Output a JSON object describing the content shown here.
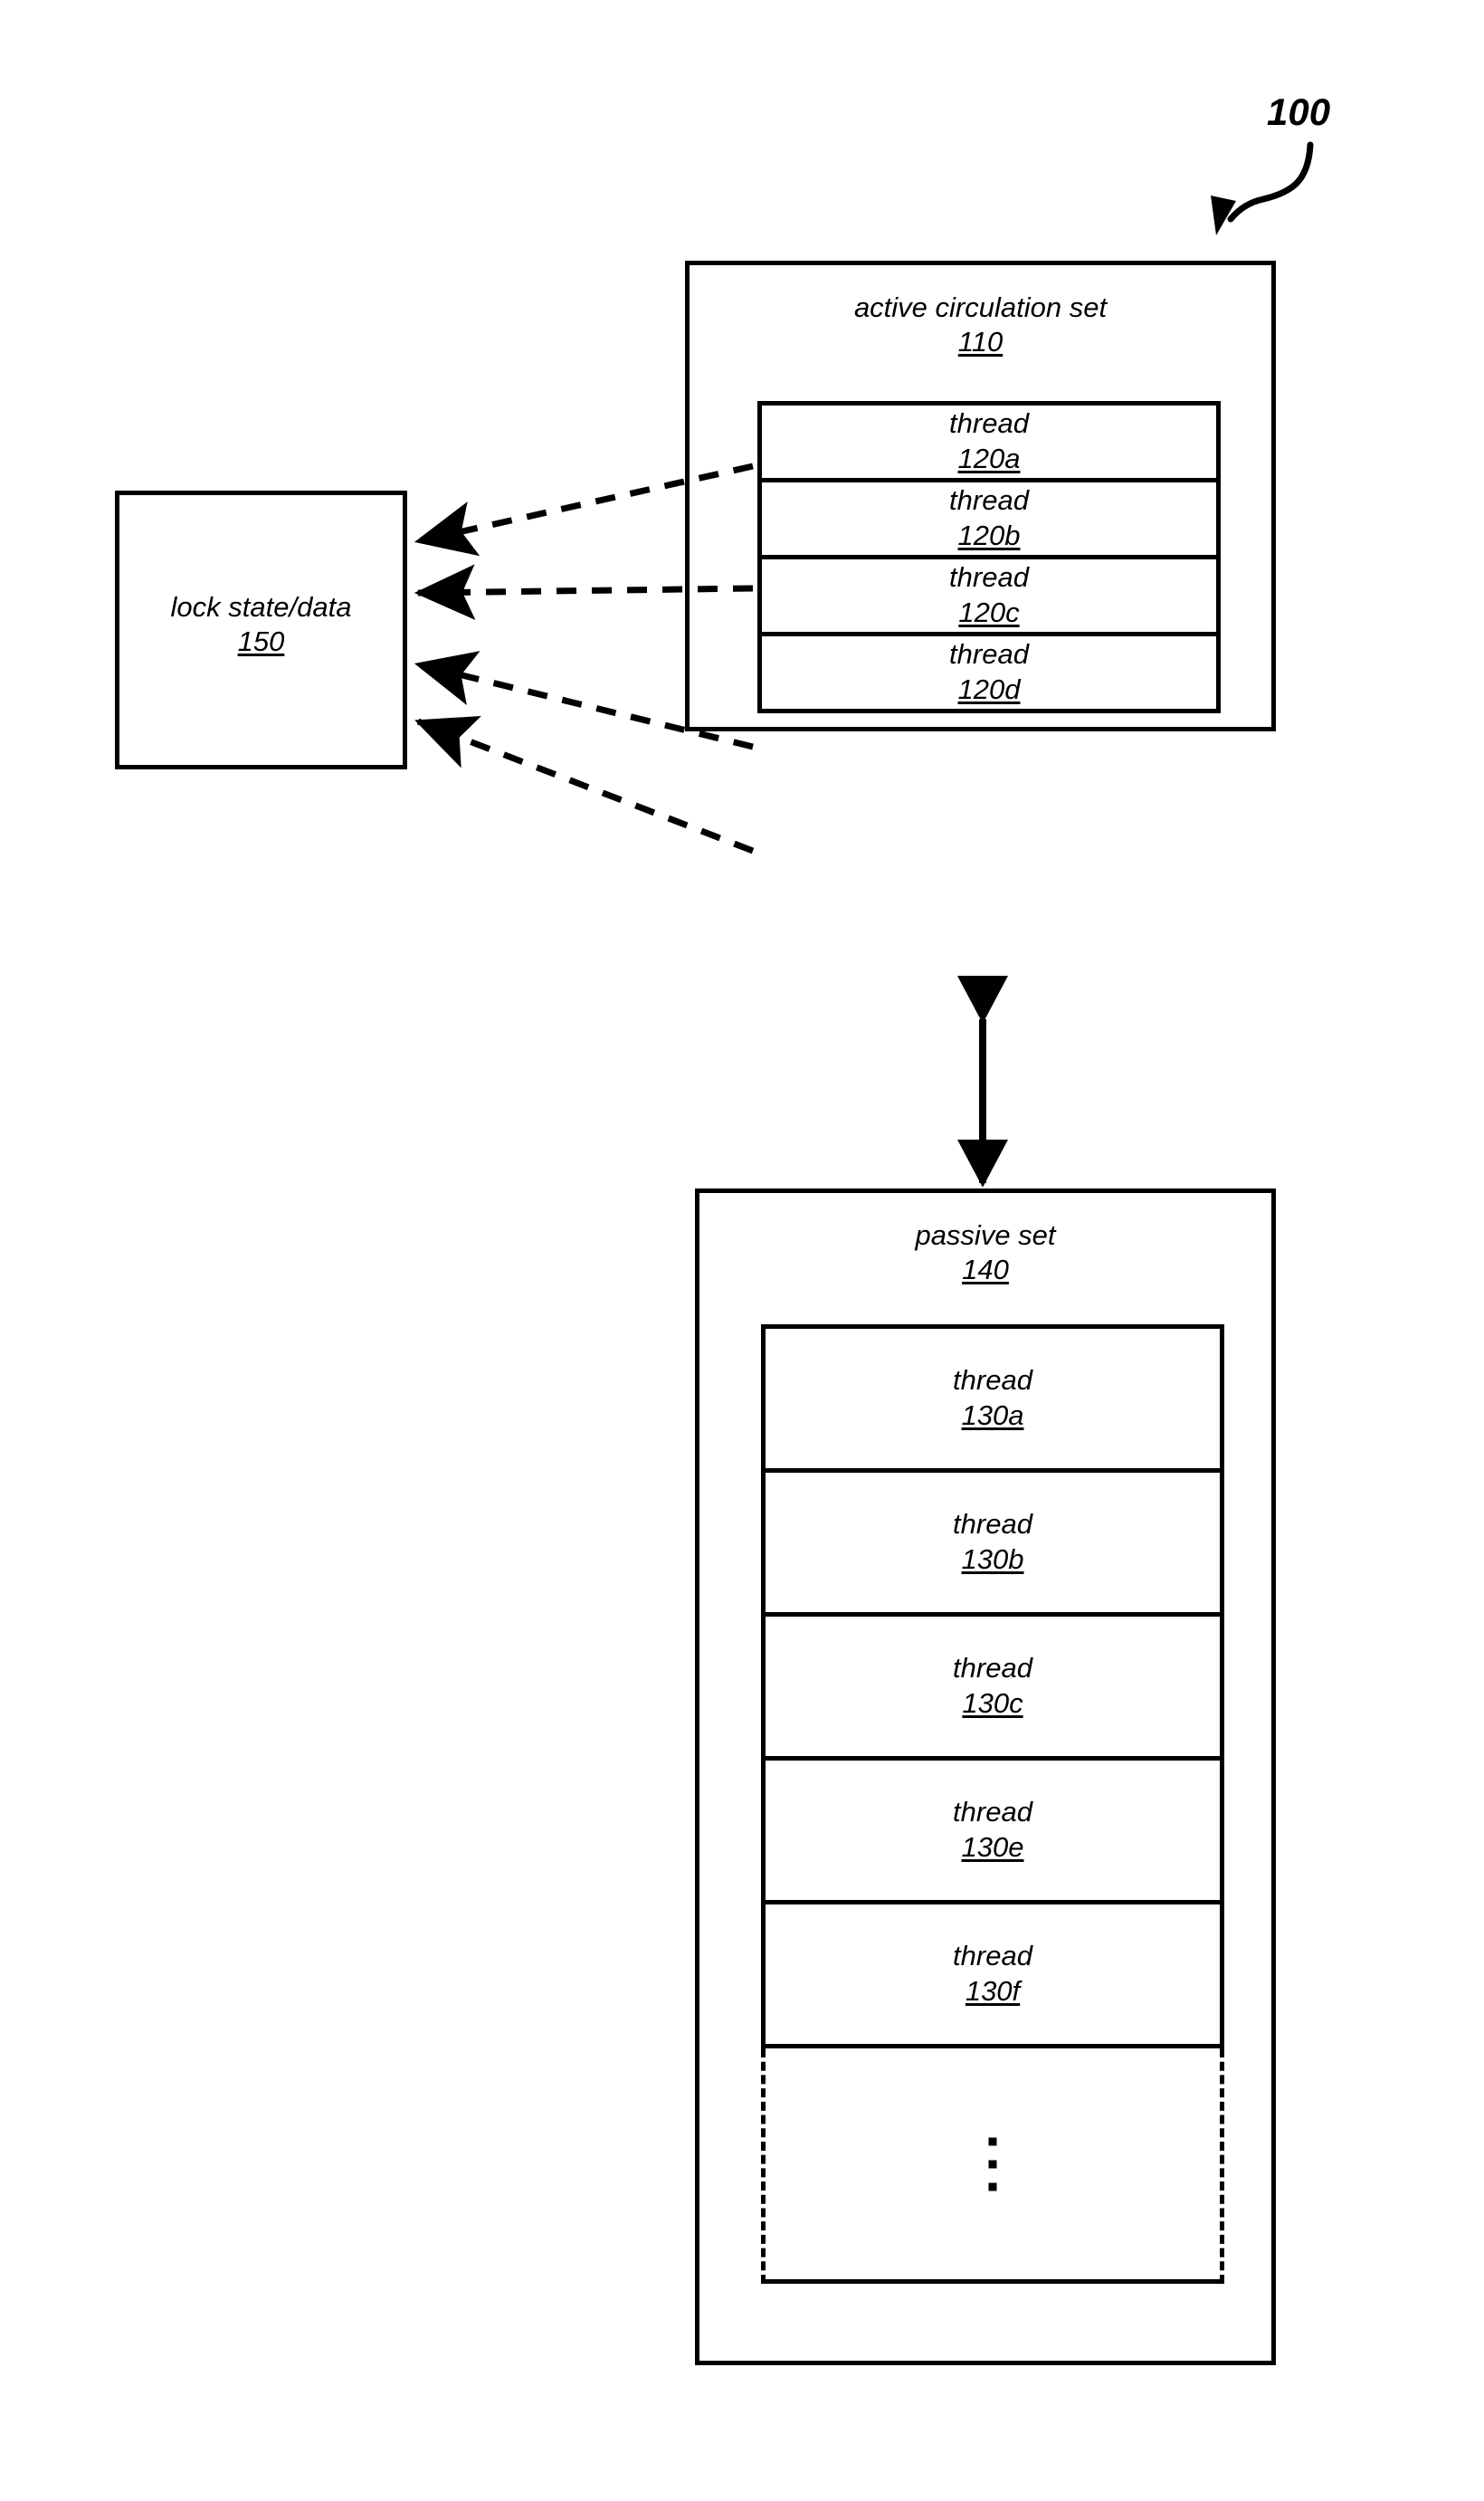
{
  "figure": {
    "number": "100",
    "number_icon": "curved-arrow-icon"
  },
  "lock": {
    "title": "lock state/data",
    "ref": "150"
  },
  "active_set": {
    "title": "active circulation set",
    "ref": "110",
    "threads": [
      {
        "title": "thread",
        "ref": "120a"
      },
      {
        "title": "thread",
        "ref": "120b"
      },
      {
        "title": "thread",
        "ref": "120c"
      },
      {
        "title": "thread",
        "ref": "120d"
      }
    ]
  },
  "passive_set": {
    "title": "passive set",
    "ref": "140",
    "threads": [
      {
        "title": "thread",
        "ref": "130a"
      },
      {
        "title": "thread",
        "ref": "130b"
      },
      {
        "title": "thread",
        "ref": "130c"
      },
      {
        "title": "thread",
        "ref": "130e"
      },
      {
        "title": "thread",
        "ref": "130f"
      }
    ],
    "continuation": "vertical-ellipsis"
  },
  "connectors": {
    "thread_to_lock": "dashed-arrow",
    "thread_to_lock_count": 4,
    "set_to_set": "double-headed-arrow"
  },
  "colors": {
    "stroke": "#000000",
    "background": "#ffffff"
  }
}
